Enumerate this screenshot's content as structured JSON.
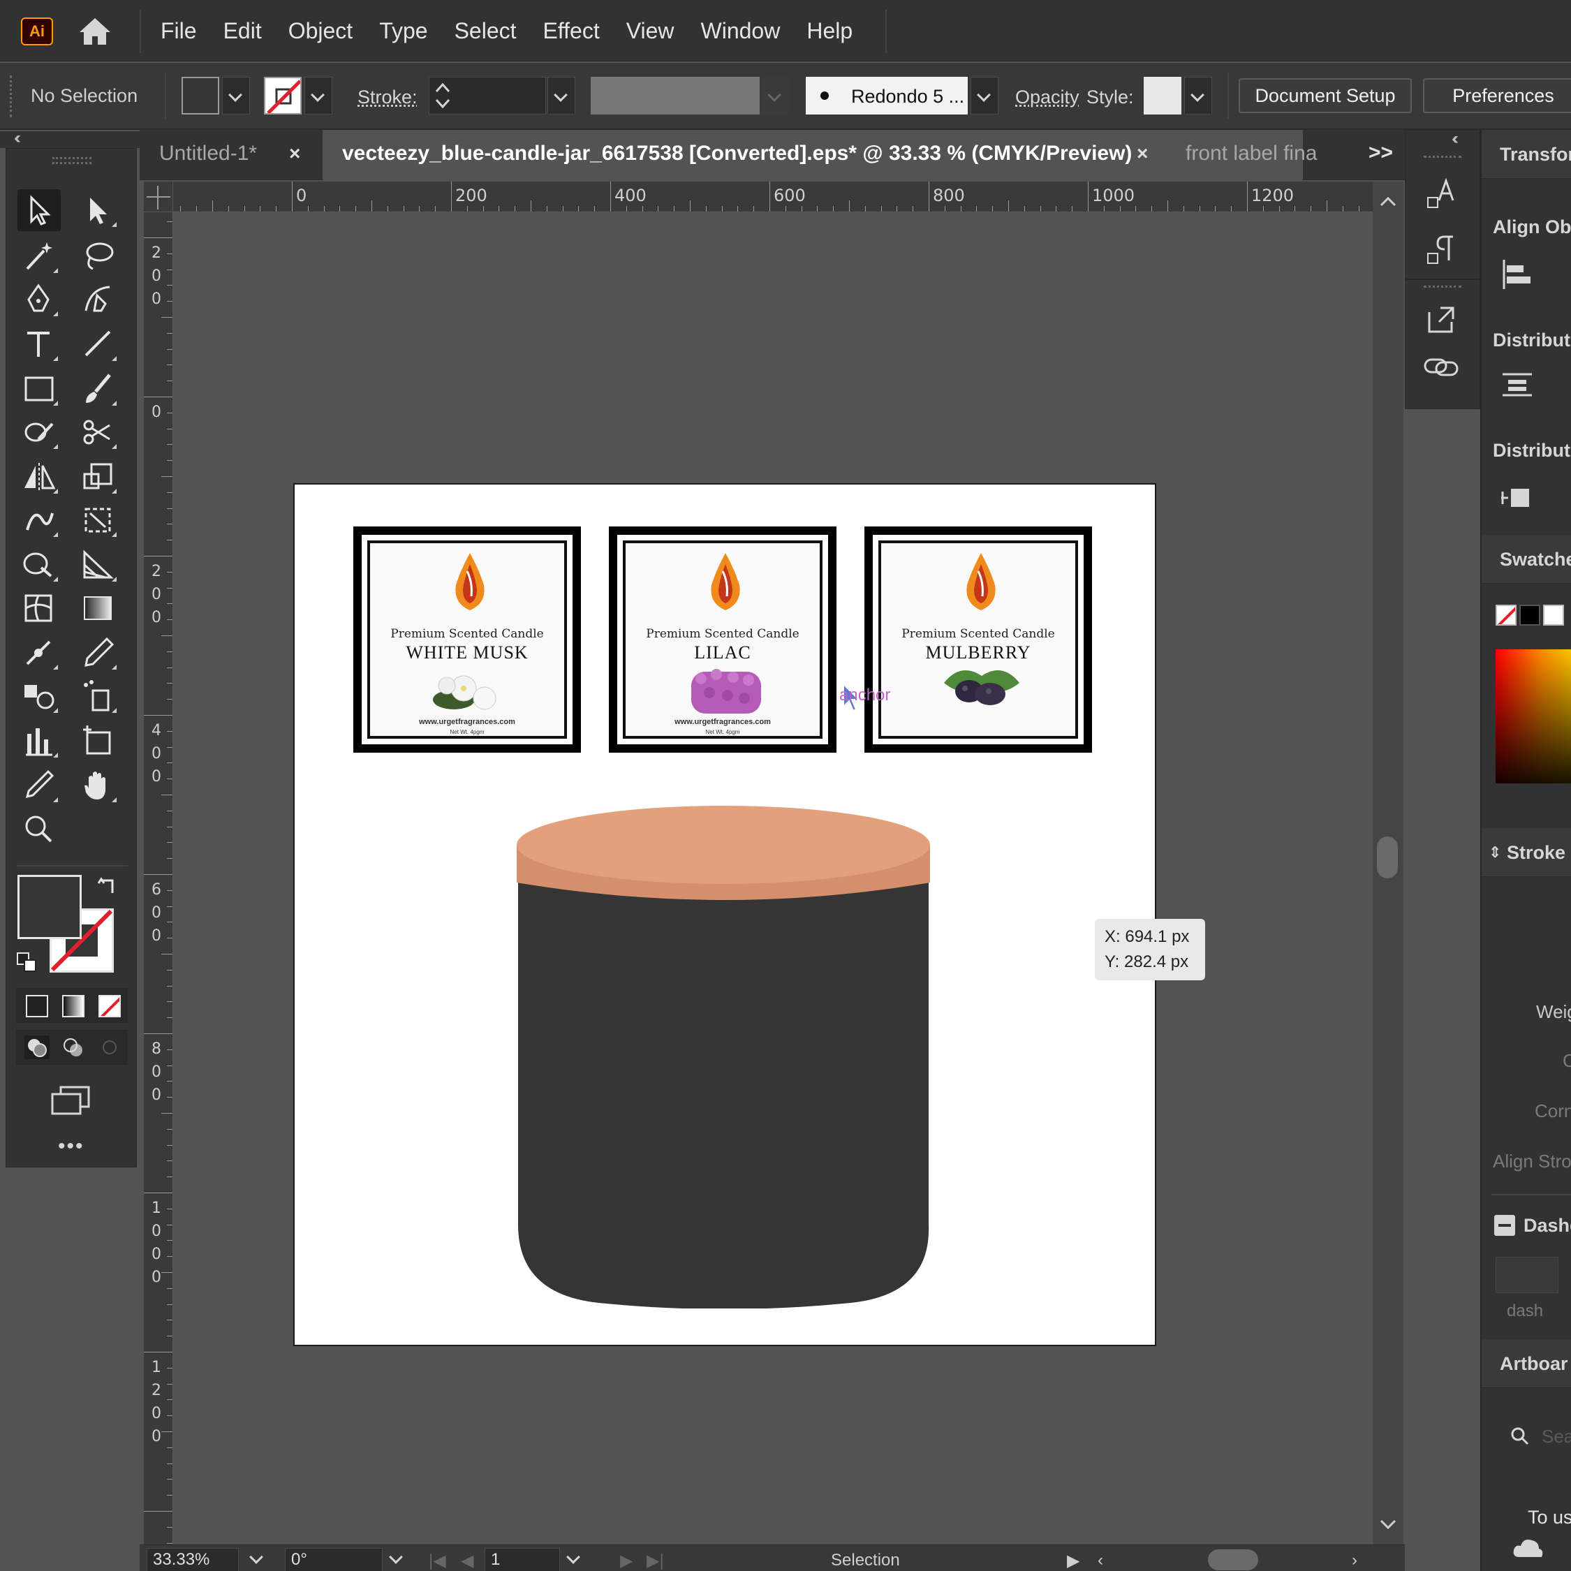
{
  "app": {
    "logo": "Ai",
    "home_icon": "home-icon"
  },
  "menu": [
    "File",
    "Edit",
    "Object",
    "Type",
    "Select",
    "Effect",
    "View",
    "Window",
    "Help"
  ],
  "control_bar": {
    "selection_status": "No Selection",
    "fill_color": "#353535",
    "stroke_color": "none",
    "stroke_label": "Stroke:",
    "brush_label": "Redondo 5 ...",
    "opacity_label": "Opacity",
    "style_label": "Style:",
    "document_setup": "Document Setup",
    "preferences": "Preferences"
  },
  "tabs": [
    {
      "label": "Untitled-1*",
      "active": false
    },
    {
      "label": "vecteezy_blue-candle-jar_6617538 [Converted].eps* @ 33.33 % (CMYK/Preview)",
      "active": true
    },
    {
      "label": "front label fina",
      "active": false
    }
  ],
  "tab_overflow": ">>",
  "rulers": {
    "horizontal": [
      "0",
      "200",
      "400",
      "600",
      "800",
      "1000",
      "1200"
    ],
    "vertical": [
      "200",
      "0",
      "200",
      "400",
      "600",
      "800",
      "1000",
      "1200"
    ]
  },
  "labels": [
    {
      "subtitle": "Premium Scented Candle",
      "name": "WHITE MUSK",
      "url": "www.urgetfragrances.com",
      "small": "Net Wt. 4pgm",
      "accent": "#e9e6df"
    },
    {
      "subtitle": "Premium Scented Candle",
      "name": "LILAC",
      "url": "www.urgetfragrances.com",
      "small": "Net Wt. 4pgm",
      "accent": "#b65cb8"
    },
    {
      "subtitle": "Premium Scented Candle",
      "name": "MULBERRY",
      "url": "",
      "small": "",
      "accent": "#3b2f48"
    }
  ],
  "smart_guide": {
    "anchor": "anchor",
    "x": "X: 694.1 px",
    "y": "Y: 282.4 px"
  },
  "candle": {
    "lid_color": "#e2a07c",
    "lid_side_color": "#d58f6c",
    "body_color": "#353535"
  },
  "right_panels": {
    "transform": "Transfor",
    "align_objects": "Align Obje",
    "distribute_objects": "Distribute",
    "distribute_spacing": "Distribute",
    "swatches": "Swatche",
    "stroke": "Stroke",
    "weight": "Weig",
    "cap": "C",
    "corner": "Corn",
    "align_stroke": "Align Stro",
    "dashed": "Dashe",
    "dash": "dash",
    "artboards": "Artboar",
    "search_placeholder": "Sea",
    "footer": "To us"
  },
  "status_bar": {
    "zoom": "33.33%",
    "rotation": "0°",
    "artboard_number": "1",
    "mode": "Selection"
  }
}
